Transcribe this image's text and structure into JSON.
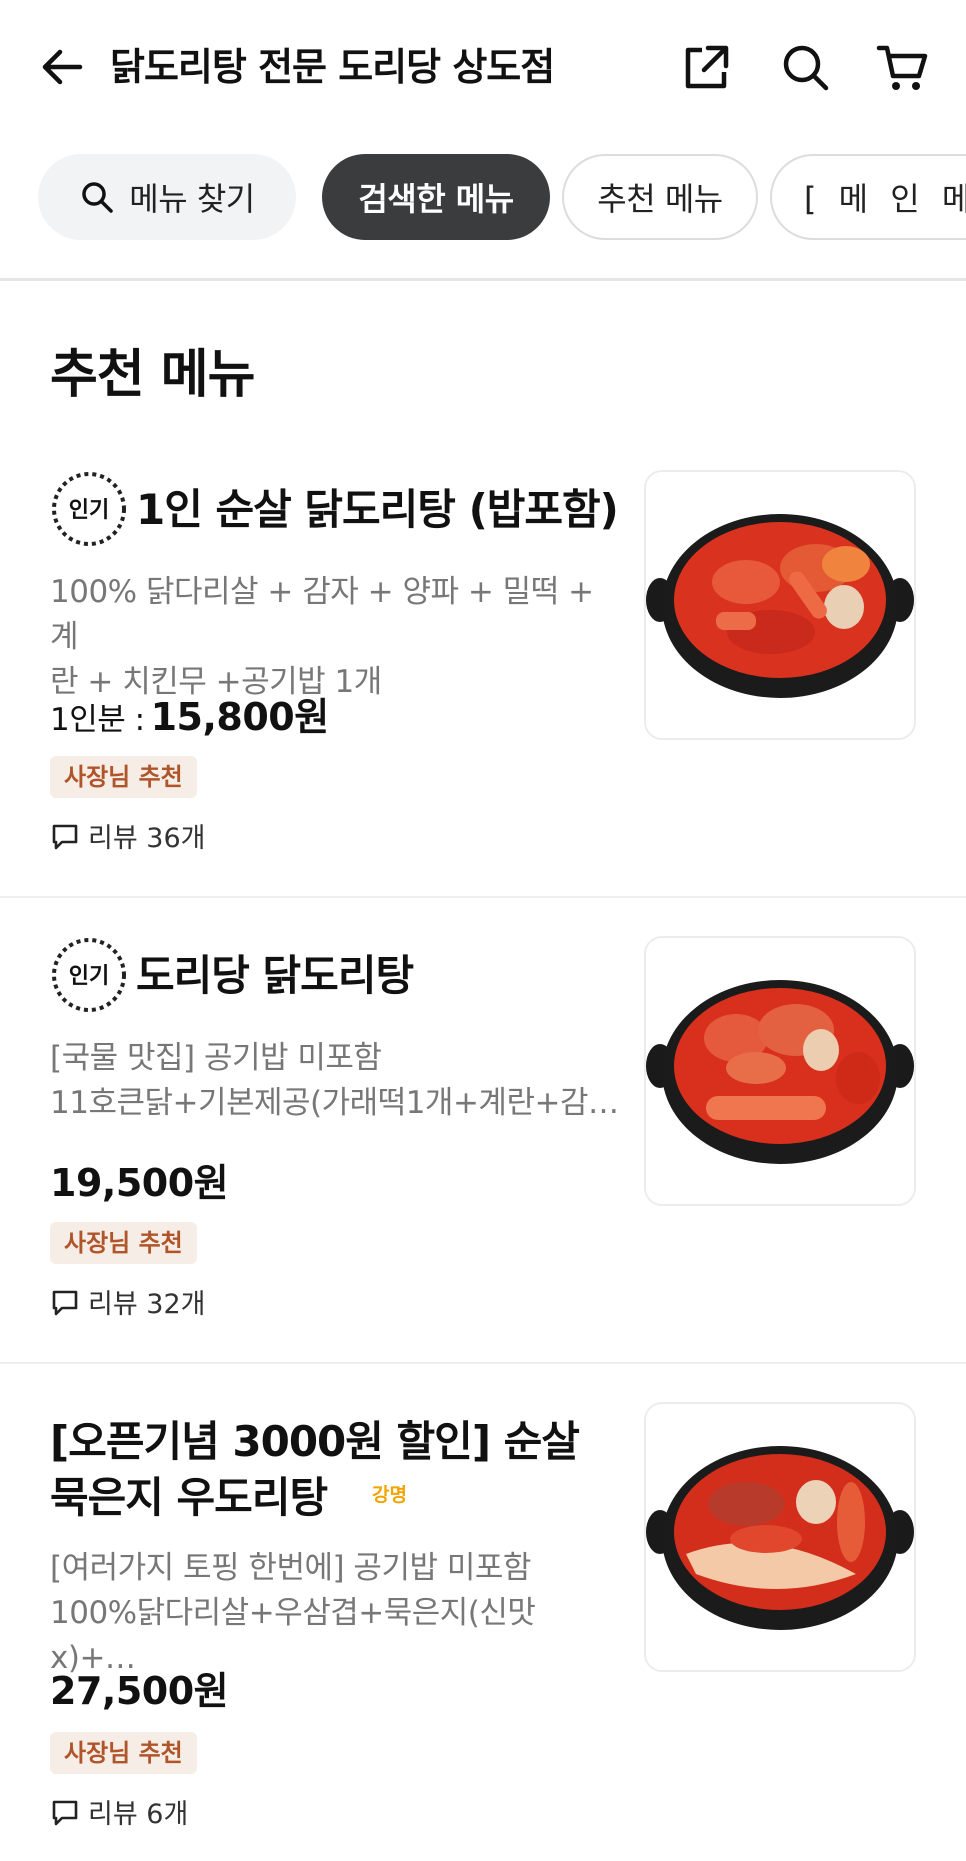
{
  "header": {
    "back_icon": "arrow-left-icon",
    "title": "닭도리탕 전문 도리당 상도점",
    "share_icon": "share-icon",
    "search_icon": "search-icon",
    "cart_icon": "cart-icon"
  },
  "tabs": {
    "search_label": "메뉴 찾기",
    "items": [
      "검색한 메뉴",
      "추천 메뉴",
      "[ 메 인 메 뉴"
    ]
  },
  "section_title": "추천 메뉴",
  "menu_items": [
    {
      "badge": "인기",
      "name": "1인 순살 닭도리탕 (밥포함)",
      "desc_line1": "100% 닭다리살 + 감자 + 양파 + 밀떡 + 계",
      "desc_line2": "란 + 치킨무 +공기밥 1개",
      "price_label": "1인분 :",
      "price": "15,800원",
      "tag": "사장님 추천",
      "reviews": "리뷰 36개"
    },
    {
      "badge": "인기",
      "name": "도리당 닭도리탕",
      "desc_line1": "[국물 맛집] 공기밥 미포함",
      "desc_line2": "11호큰닭+기본제공(가래떡1개+계란+감…",
      "price": "19,500원",
      "tag": "사장님 추천",
      "reviews": "리뷰 32개"
    },
    {
      "name_line1": "[오픈기념 3000원 할인] 순살",
      "name_line2": "묵은지 우도리탕",
      "extra_mark": "강명",
      "desc_line1": "[여러가지 토핑 한번에] 공기밥 미포함",
      "desc_line2": "100%닭다리살+우삼겹+묵은지(신맛x)+…",
      "price": "27,500원",
      "tag": "사장님 추천",
      "reviews": "리뷰 6개"
    }
  ],
  "colors": {
    "chip_active_bg": "#3b3c3e",
    "tag_bg": "#f6ede6",
    "tag_text": "#b0552a",
    "stew_red": "#d9321f"
  }
}
